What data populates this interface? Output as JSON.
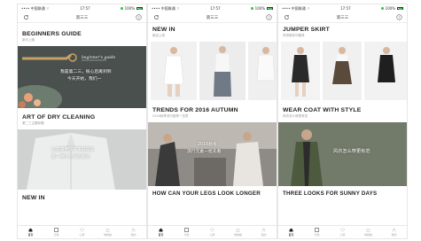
{
  "status": {
    "carrier": "•••• 中国联通 ⌔",
    "time": "17:57",
    "battery": "100%"
  },
  "nav": {
    "title": "第三三"
  },
  "tabs": [
    "首页",
    "分类",
    "心愿",
    "购物袋",
    "我的"
  ],
  "screen1": {
    "s1_title": "BEGINNERS GUIDE",
    "s1_sub": "新手上路",
    "s1_overlay_title": "beginner's guide",
    "s1_overlay_line1": "我是第二三，很心后再到到",
    "s1_overlay_line2": "今天开始，我们一",
    "s2_title": "ART OF DRY CLEANING",
    "s2_sub": "第二三主题标题",
    "s2_overlay_line1": "比衣服更洗干净得得得",
    "s2_overlay_line2": "是一种什么样的体验",
    "s3_title": "NEW IN"
  },
  "screen2": {
    "s1_title": "NEW IN",
    "s1_sub": "新品上线",
    "s2_title": "TRENDS FOR 2016 AUTUMN",
    "s2_sub": "2016秋季流行趋势一览表",
    "s2_overlay_line1": "2016秋冬",
    "s2_overlay_line2": "流行元素一抢先看",
    "s3_title": "HOW CAN YOUR LEGS LOOK LONGER"
  },
  "screen3": {
    "s1_title": "JUMPER SKIRT",
    "s1_sub": "背带裙系列推荐",
    "s2_title": "WEAR COAT WITH STYLE",
    "s2_sub": "风衣怎么穿更有范",
    "s2_overlay": "风衣怎么穿更有范",
    "s3_title": "THREE LOOKS FOR SUNNY DAYS"
  }
}
